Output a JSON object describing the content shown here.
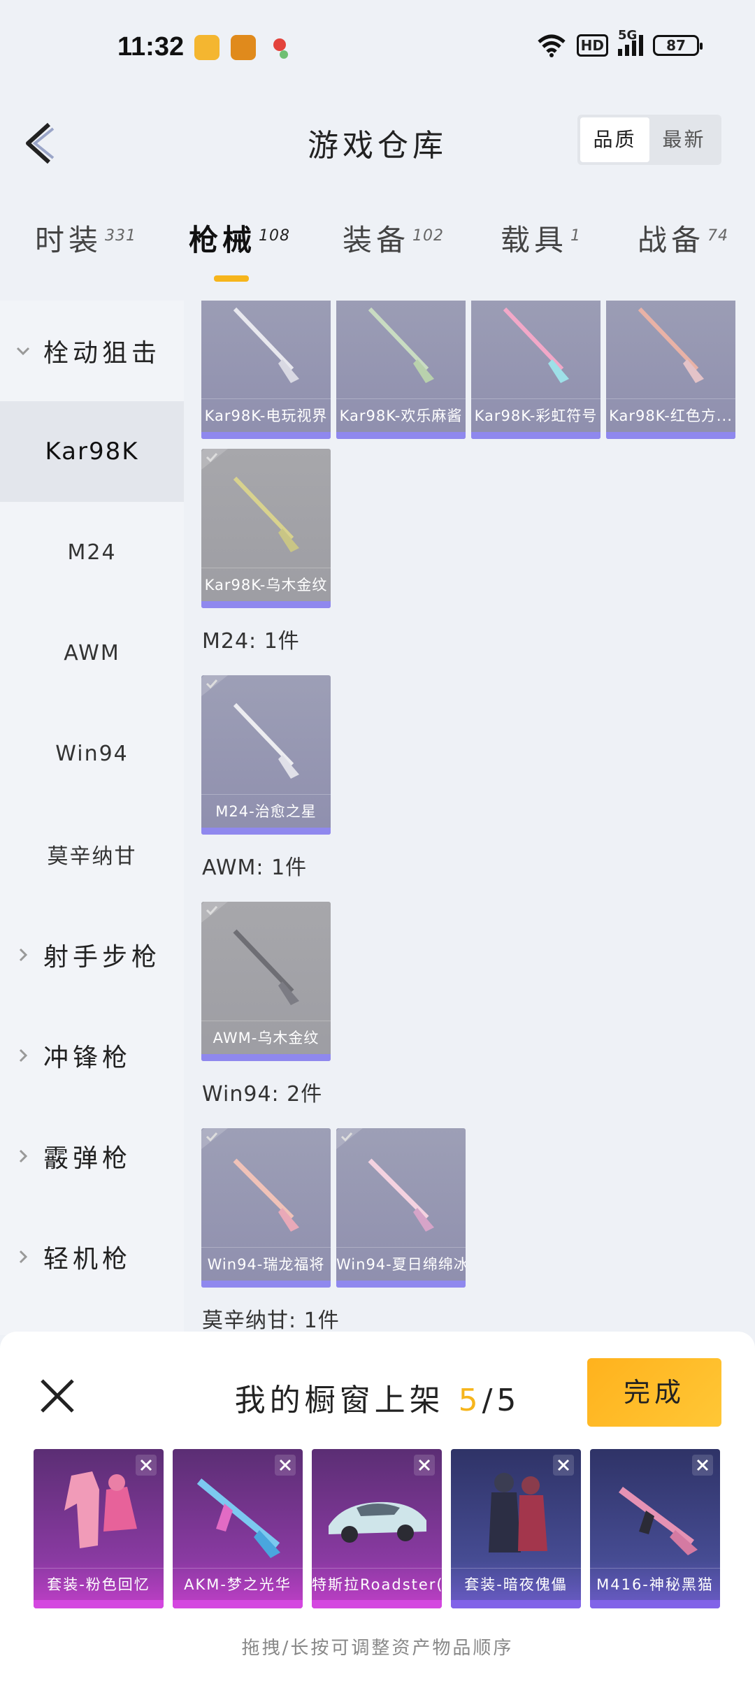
{
  "status_bar": {
    "time": "11:32",
    "network": "HD",
    "signal": "5G",
    "battery": "87"
  },
  "header": {
    "title": "游戏仓库",
    "sort_options": [
      "品质",
      "最新"
    ],
    "active_sort": "品质"
  },
  "tabs": [
    {
      "label": "时装",
      "count": "331"
    },
    {
      "label": "枪械",
      "count": "108"
    },
    {
      "label": "装备",
      "count": "102"
    },
    {
      "label": "载具",
      "count": "1"
    },
    {
      "label": "战备",
      "count": "74"
    }
  ],
  "active_tab": "枪械",
  "sidebar": {
    "items": [
      {
        "label": "栓动狙击",
        "type": "group",
        "expanded": true
      },
      {
        "label": "Kar98K",
        "type": "sub",
        "selected": true
      },
      {
        "label": "M24",
        "type": "sub"
      },
      {
        "label": "AWM",
        "type": "sub"
      },
      {
        "label": "Win94",
        "type": "sub"
      },
      {
        "label": "莫辛纳甘",
        "type": "sub"
      },
      {
        "label": "射手步枪",
        "type": "group"
      },
      {
        "label": "冲锋枪",
        "type": "group"
      },
      {
        "label": "霰弹枪",
        "type": "group"
      },
      {
        "label": "轻机枪",
        "type": "group"
      }
    ]
  },
  "content": {
    "kar98k_items": [
      "Kar98K-电玩视界",
      "Kar98K-欢乐麻酱",
      "Kar98K-彩虹符号",
      "Kar98K-红色方...",
      "Kar98K-乌木金纹"
    ],
    "sections": [
      {
        "title": "M24: 1件",
        "items": [
          "M24-治愈之星"
        ]
      },
      {
        "title": "AWM: 1件",
        "items": [
          "AWM-乌木金纹"
        ]
      },
      {
        "title": "Win94: 2件",
        "items": [
          "Win94-瑞龙福将",
          "Win94-夏日绵绵冰"
        ]
      },
      {
        "title": "莫辛纳甘: 1件",
        "items": []
      }
    ]
  },
  "shelf": {
    "title_prefix": "我的橱窗上架",
    "current": "5",
    "separator": "/",
    "total": "5",
    "done_label": "完成",
    "items": [
      "套装-粉色回忆",
      "AKM-梦之光华",
      "特斯拉Roadster(...",
      "套装-暗夜傀儡",
      "M416-神秘黑猫"
    ],
    "hint": "拖拽/长按可调整资产物品顺序"
  },
  "colors": {
    "accent": "#f6b51c",
    "card_purple": "#9d9fb6",
    "card_grey": "#a7a7ab",
    "card_bar": "#8f88ee"
  }
}
